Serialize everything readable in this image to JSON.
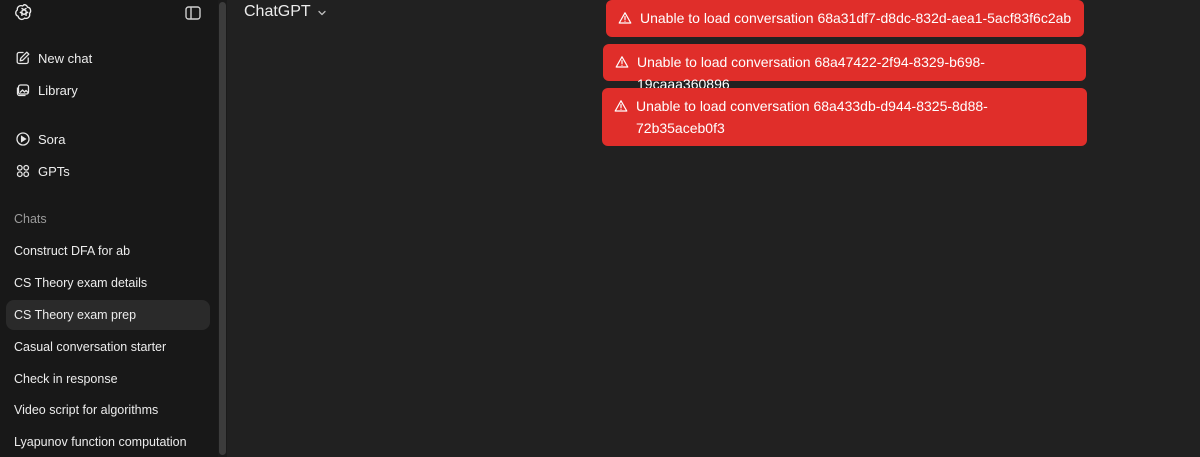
{
  "header": {
    "model_label": "ChatGPT"
  },
  "sidebar": {
    "nav": [
      {
        "label": "New chat",
        "icon": "pencil-icon"
      },
      {
        "label": "Library",
        "icon": "images-icon"
      },
      {
        "label": "Sora",
        "icon": "play-circle-icon"
      },
      {
        "label": "GPTs",
        "icon": "grid-icon"
      }
    ],
    "section_label": "Chats",
    "chats": [
      {
        "label": "Construct DFA for ab",
        "active": false
      },
      {
        "label": "CS Theory exam details",
        "active": false
      },
      {
        "label": "CS Theory exam prep",
        "active": true
      },
      {
        "label": "Casual conversation starter",
        "active": false
      },
      {
        "label": "Check in response",
        "active": false
      },
      {
        "label": "Video script for algorithms",
        "active": false
      },
      {
        "label": "Lyapunov function computation",
        "active": false
      }
    ]
  },
  "toasts": [
    {
      "message": "Unable to load conversation 68a31df7-d8dc-832d-aea1-5acf83f6c2ab"
    },
    {
      "message": "Unable to load conversation 68a47422-2f94-8329-b698-19caaa360896"
    },
    {
      "message": "Unable to load conversation 68a433db-d944-8325-8d88-72b35aceb0f3"
    }
  ],
  "colors": {
    "sidebar_bg": "#181818",
    "main_bg": "#212121",
    "toast_bg": "#e02e2a",
    "active_chat_bg": "#2a2a2a"
  }
}
